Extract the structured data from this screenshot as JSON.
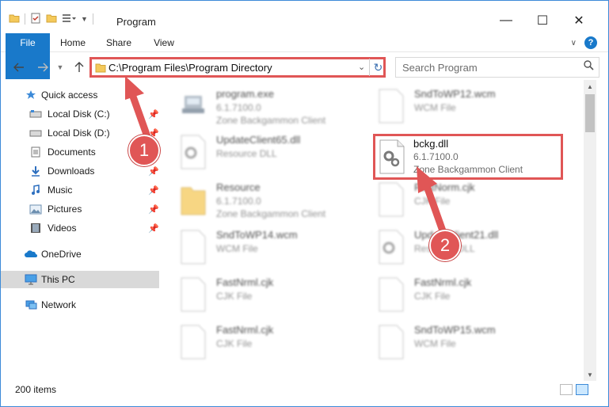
{
  "window": {
    "title": "Program",
    "controls": {
      "minimize": "—",
      "maximize": "☐",
      "close": "✕"
    }
  },
  "ribbon": {
    "tabs": [
      {
        "label": "File",
        "active": true
      },
      {
        "label": "Home"
      },
      {
        "label": "Share"
      },
      {
        "label": "View"
      }
    ],
    "help_label": "?"
  },
  "navigation": {
    "address_path": "C:\\Program Files\\Program Directory",
    "search_placeholder": "Search Program"
  },
  "sidebar": {
    "items": [
      {
        "label": "Quick access",
        "icon": "star-icon"
      },
      {
        "label": "Local Disk (C:)",
        "icon": "drive-icon",
        "pinned": true
      },
      {
        "label": "Local Disk (D:)",
        "icon": "drive-icon",
        "pinned": true
      },
      {
        "label": "Documents",
        "icon": "documents-icon",
        "pinned": true
      },
      {
        "label": "Downloads",
        "icon": "download-icon",
        "pinned": true
      },
      {
        "label": "Music",
        "icon": "music-icon",
        "pinned": true
      },
      {
        "label": "Pictures",
        "icon": "pictures-icon",
        "pinned": true
      },
      {
        "label": "Videos",
        "icon": "videos-icon",
        "pinned": true
      },
      {
        "label": "OneDrive",
        "icon": "onedrive-icon"
      },
      {
        "label": "This PC",
        "icon": "pc-icon",
        "selected": true
      },
      {
        "label": "Network",
        "icon": "network-icon"
      }
    ]
  },
  "files": [
    {
      "name": "program.exe",
      "line2": "6.1.7100.0",
      "line3": "Zone Backgammon Client",
      "icon": "exe-icon"
    },
    {
      "name": "SndToWP12.wcm",
      "line2": "WCM File",
      "line3": "",
      "icon": "blank-file-icon"
    },
    {
      "name": "UpdateClient65.dll",
      "line2": "Resource DLL",
      "line3": "",
      "icon": "dll-icon"
    },
    {
      "name": "Resource",
      "line2": "6.1.7100.0",
      "line3": "Zone Backgammon Client",
      "icon": "folder-icon"
    },
    {
      "name": "FastNorm.cjk",
      "line2": "CJK File",
      "line3": "",
      "icon": "blank-file-icon"
    },
    {
      "name": "SndToWP14.wcm",
      "line2": "WCM File",
      "line3": "",
      "icon": "blank-file-icon"
    },
    {
      "name": "UpdateClient21.dll",
      "line2": "Resource DLL",
      "line3": "",
      "icon": "dll-icon"
    },
    {
      "name": "FastNrml.cjk",
      "line2": "CJK File",
      "line3": "",
      "icon": "blank-file-icon"
    },
    {
      "name": "FastNrml.cjk",
      "line2": "CJK File",
      "line3": "",
      "icon": "blank-file-icon"
    },
    {
      "name": "FastNrml.cjk",
      "line2": "CJK File",
      "line3": "",
      "icon": "blank-file-icon"
    },
    {
      "name": "SndToWP15.wcm",
      "line2": "WCM File",
      "line3": "",
      "icon": "blank-file-icon"
    }
  ],
  "highlighted_file": {
    "name": "bckg.dll",
    "line2": "6.1.7100.0",
    "line3": "Zone Backgammon Client",
    "icon": "dll-icon"
  },
  "callouts": [
    {
      "label": "1"
    },
    {
      "label": "2"
    }
  ],
  "status": {
    "item_count": "200 items"
  },
  "colors": {
    "accent": "#1979ca",
    "callout": "#e05656",
    "selection": "#cce8ff"
  }
}
